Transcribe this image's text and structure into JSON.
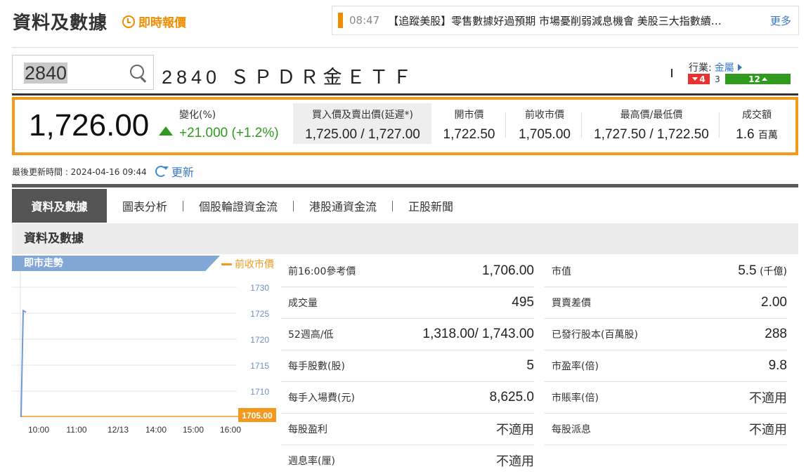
{
  "header": {
    "title": "資料及數據",
    "realtime_link": "即時報價"
  },
  "news_ticker": {
    "time": "08:47",
    "headline": "【追蹤美股】零售數據好過預期 市場憂削弱減息機會 美股三大指數續…",
    "more": "更多"
  },
  "search": {
    "value": "2840"
  },
  "stock": {
    "name": "2840 ＳＰＤＲ金ＥＴＦ",
    "industry_label": "行業:",
    "industry_value": "金屬",
    "breadth": {
      "down": "4",
      "flat": "3",
      "up": "12"
    }
  },
  "quote": {
    "last": "1,726.00",
    "change_label": "變化(%)",
    "change_value": "+21.000 (+1.2%)",
    "bid_ask_label": "買入價及賣出價(延遲*)",
    "bid_ask_value": "1,725.00 / 1,727.00",
    "open_label": "開市價",
    "open_value": "1,722.50",
    "prev_close_label": "前收市價",
    "prev_close_value": "1,705.00",
    "high_low_label": "最高價/最低價",
    "high_low_value": "1,727.50 / 1,722.50",
    "turnover_label": "成交額",
    "turnover_value": "1.6",
    "turnover_unit": "百萬",
    "colors": {
      "up": "#2f9a1e",
      "down": "#e8322f",
      "accent": "#f39a1e",
      "link": "#3a78c3"
    }
  },
  "update": {
    "label": "最後更新時間 : 2024-04-16 09:44",
    "refresh": "更新"
  },
  "tabs": [
    {
      "label": "資料及數據",
      "active": true
    },
    {
      "label": "圖表分析",
      "active": false
    },
    {
      "label": "個股輪證資金流",
      "active": false
    },
    {
      "label": "港股通資金流",
      "active": false
    },
    {
      "label": "正股新聞",
      "active": false
    }
  ],
  "section_title": "資料及數據",
  "chart_data": {
    "type": "line",
    "title": "即市走勢",
    "legend": "前收市價",
    "x_ticks": [
      "10:00",
      "11:00",
      "12/13",
      "14:00",
      "15:00",
      "16:00"
    ],
    "y_ticks": [
      1730,
      1725,
      1720,
      1715,
      1710
    ],
    "ylim": [
      1705,
      1731.5
    ],
    "prev_close": 1705.0,
    "prev_close_label": "1705.00",
    "series": [
      {
        "values": [
          1705,
          1725.5,
          1725.2
        ]
      }
    ]
  },
  "stats_left": [
    {
      "key": "前16:00參考價",
      "value": "1,706.00"
    },
    {
      "key": "成交量",
      "value": "495"
    },
    {
      "key": "52週高/低",
      "value": "1,318.00/ 1,743.00"
    },
    {
      "key": "每手股數(股)",
      "value": "5"
    },
    {
      "key": "每手入場費(元)",
      "value": "8,625.0"
    },
    {
      "key": "每股盈利",
      "value": "不適用"
    },
    {
      "key": "週息率(厘)",
      "value": "不適用"
    }
  ],
  "stats_right": [
    {
      "key": "市值",
      "value": "5.5",
      "unit": "(千億)"
    },
    {
      "key": "買賣差價",
      "value": "2.00"
    },
    {
      "key": "已發行股本(百萬股)",
      "value": "288"
    },
    {
      "key": "市盈率(倍)",
      "value": "9.8"
    },
    {
      "key": "市賬率(倍)",
      "value": "不適用"
    },
    {
      "key": "每股派息",
      "value": "不適用"
    }
  ]
}
